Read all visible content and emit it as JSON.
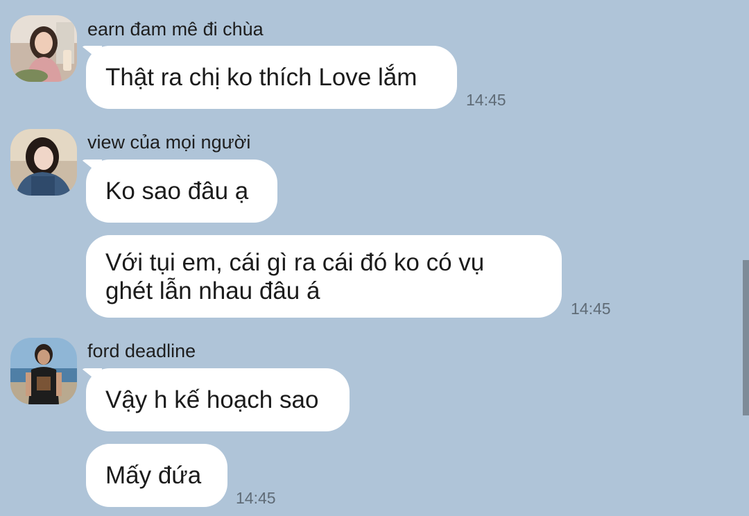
{
  "messages": [
    {
      "sender": "earn đam mê đi chùa",
      "avatar": "avatar-photo",
      "bubbles": [
        "Thật ra chị ko thích Love lắm"
      ],
      "time": "14:45"
    },
    {
      "sender": "view của mọi người",
      "avatar": "avatar-photo",
      "bubbles": [
        "Ko sao đâu ạ",
        "Với tụi em, cái gì ra cái đó ko có vụ ghét lẫn nhau đâu á"
      ],
      "time": "14:45"
    },
    {
      "sender": "ford deadline",
      "avatar": "avatar-photo",
      "bubbles": [
        "Vậy h kế hoạch sao",
        "Mấy đứa"
      ],
      "time": "14:45"
    }
  ],
  "colors": {
    "background": "#afc4d8",
    "bubble": "#ffffff",
    "timestamp": "#5f6b76",
    "scrollbar": "#7d8b98"
  }
}
